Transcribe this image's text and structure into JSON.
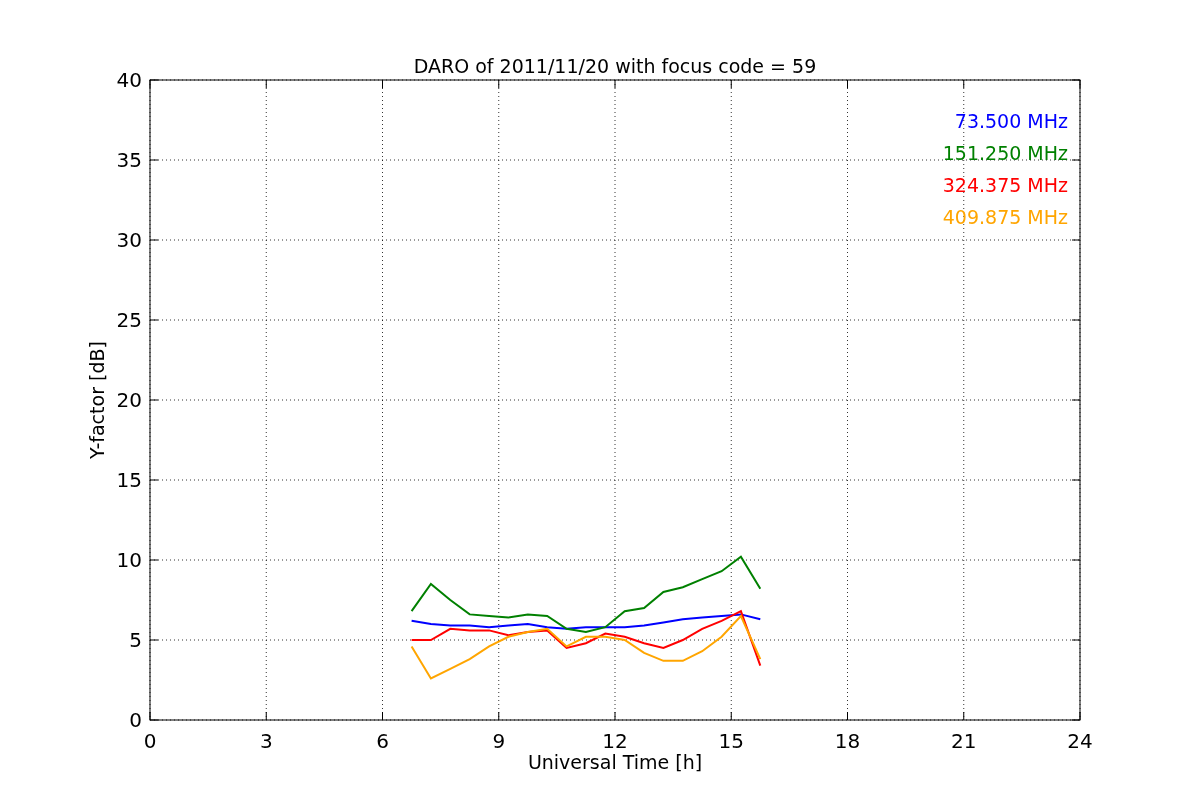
{
  "chart_data": {
    "type": "line",
    "title": "DARO of 2011/11/20 with focus code = 59",
    "xlabel": "Universal Time [h]",
    "ylabel": "Y-factor [dB]",
    "x": [
      6.75,
      7.25,
      7.75,
      8.25,
      8.75,
      9.25,
      9.75,
      10.25,
      10.75,
      11.25,
      11.75,
      12.25,
      12.75,
      13.25,
      13.75,
      14.25,
      14.75,
      15.25,
      15.75
    ],
    "series": [
      {
        "name": "73.500 MHz",
        "color": "#0000ff",
        "values": [
          6.2,
          6.0,
          5.9,
          5.9,
          5.8,
          5.9,
          6.0,
          5.8,
          5.7,
          5.8,
          5.8,
          5.8,
          5.9,
          6.1,
          6.3,
          6.4,
          6.5,
          6.6,
          6.3
        ]
      },
      {
        "name": "151.250 MHz",
        "color": "#008000",
        "values": [
          6.8,
          8.5,
          7.5,
          6.6,
          6.5,
          6.4,
          6.6,
          6.5,
          5.7,
          5.5,
          5.8,
          6.8,
          7.0,
          8.0,
          8.3,
          8.8,
          9.3,
          10.2,
          8.2
        ]
      },
      {
        "name": "324.375 MHz",
        "color": "#ff0000",
        "values": [
          5.0,
          5.0,
          5.7,
          5.6,
          5.6,
          5.3,
          5.5,
          5.6,
          4.5,
          4.8,
          5.4,
          5.2,
          4.8,
          4.5,
          5.0,
          5.7,
          6.2,
          6.8,
          3.4
        ]
      },
      {
        "name": "409.875 MHz",
        "color": "#ffa500",
        "values": [
          4.6,
          2.6,
          3.2,
          3.8,
          4.6,
          5.2,
          5.5,
          5.7,
          4.6,
          5.2,
          5.2,
          5.0,
          4.2,
          3.7,
          3.7,
          4.3,
          5.2,
          6.5,
          3.8
        ]
      }
    ],
    "xlim": [
      0,
      24
    ],
    "ylim": [
      0,
      40
    ],
    "xticks": [
      0,
      3,
      6,
      9,
      12,
      15,
      18,
      21,
      24
    ],
    "yticks": [
      0,
      5,
      10,
      15,
      20,
      25,
      30,
      35,
      40
    ],
    "grid": true
  }
}
